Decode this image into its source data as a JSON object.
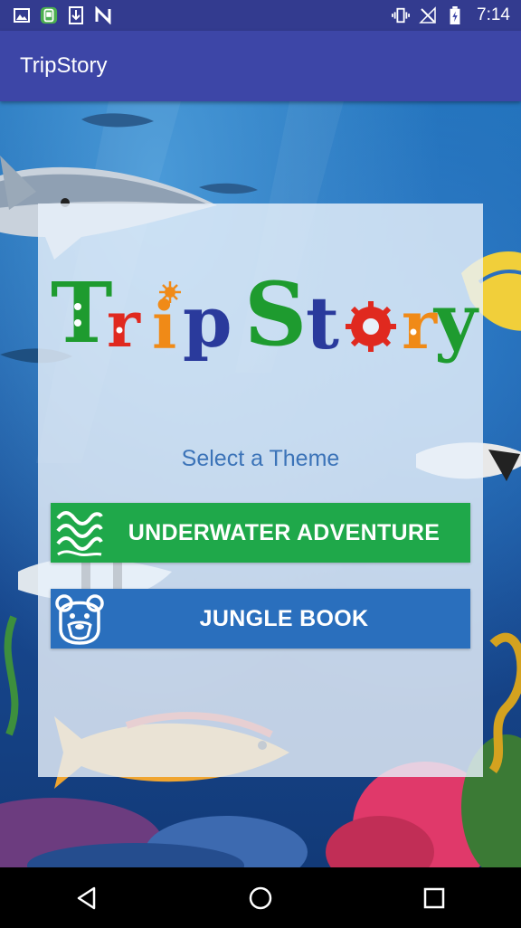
{
  "status_bar": {
    "time": "7:14",
    "left_icons": [
      "gallery-icon",
      "app-icon",
      "download-icon",
      "n-icon"
    ],
    "right_icons": [
      "vibrate-icon",
      "no-signal-icon",
      "battery-icon"
    ]
  },
  "app_bar": {
    "title": "TripStory"
  },
  "logo": {
    "text": "Trip Story",
    "letters": [
      {
        "char": "T",
        "color": "#1e9b2f"
      },
      {
        "char": "r",
        "color": "#e0291f"
      },
      {
        "char": "i",
        "color": "#f08a17"
      },
      {
        "char": "p",
        "color": "#2a3a9c"
      },
      {
        "char": "S",
        "color": "#1e9b2f"
      },
      {
        "char": "t",
        "color": "#2a3a9c"
      },
      {
        "char": "o",
        "color": "#e0291f"
      },
      {
        "char": "r",
        "color": "#f08a17"
      },
      {
        "char": "y",
        "color": "#1e9b2f"
      }
    ]
  },
  "content": {
    "prompt": "Select a Theme",
    "themes": [
      {
        "label": "UNDERWATER ADVENTURE",
        "icon": "waves-icon",
        "color": "#1fa84a"
      },
      {
        "label": "JUNGLE BOOK",
        "icon": "bear-icon",
        "color": "#2a6fbd"
      }
    ]
  },
  "nav_bar": {
    "buttons": [
      "back-icon",
      "home-icon",
      "recents-icon"
    ]
  }
}
